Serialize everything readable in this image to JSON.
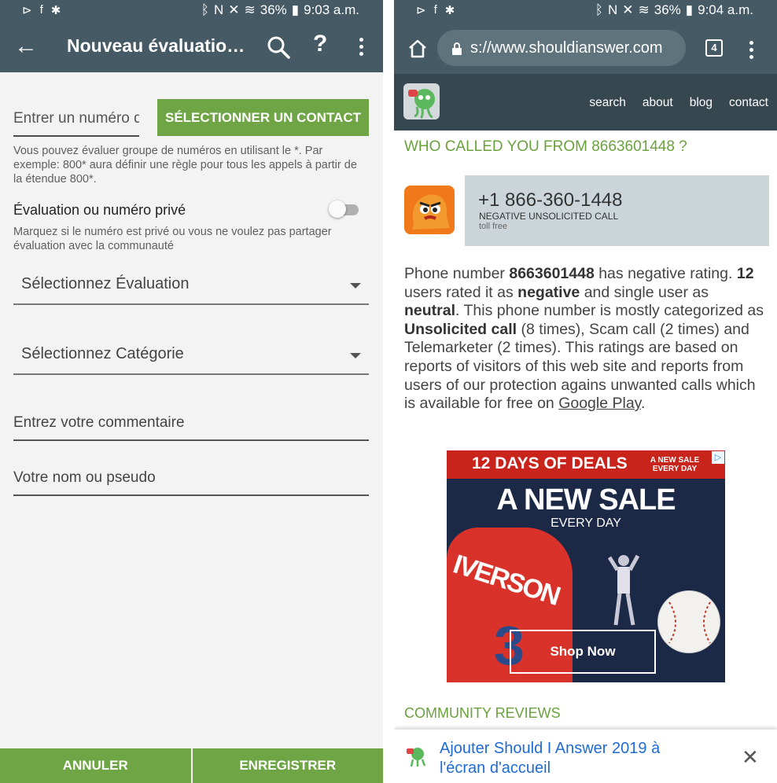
{
  "left": {
    "status": {
      "signal": "36%",
      "time": "9:03 a.m."
    },
    "appbar": {
      "title": "Nouveau évaluation…",
      "help": "?"
    },
    "number_placeholder": "Entrer un numéro de",
    "select_contact_label": "SÉLECTIONNER UN CONTACT",
    "group_hint": "Vous pouvez évaluer groupe de numéros en utilisant le *. Par exemple: 800* aura définir une règle pour tous les appels à partir de la étendue 800*.",
    "private_label": "Évaluation ou numéro privé",
    "private_hint": "Marquez si le numéro est privé ou vous ne voulez pas partager évaluation avec la communauté",
    "rating_select": "Sélectionnez Évaluation",
    "category_select": "Sélectionnez Catégorie",
    "comment_placeholder": "Entrez votre commentaire",
    "name_placeholder": "Votre nom ou pseudo",
    "cancel_label": "ANNULER",
    "save_label": "ENREGISTRER"
  },
  "right": {
    "status": {
      "signal": "36%",
      "time": "9:04 a.m."
    },
    "url": "s://www.shouldianswer.com",
    "tab_count": "4",
    "nav": [
      "search",
      "about",
      "blog",
      "contact"
    ],
    "heading": "WHO CALLED YOU FROM 8663601448 ?",
    "card": {
      "phone": "+1 866-360-1448",
      "category": "NEGATIVE UNSOLICITED CALL",
      "type": "toll free"
    },
    "paragraph": {
      "p1": "Phone number ",
      "number": "8663601448",
      "p2": " has negative rating. ",
      "count": "12",
      "p3": " users rated it as ",
      "negative": "negative",
      "p4": " and single user as ",
      "neutral": "neutral",
      "p5": ". This phone number is mostly categorized as ",
      "unsolicited": "Unsolicited call",
      "p6": " (8 times), Scam call (2 times) and Telemarketer (2 times). This ratings are based on reports of visitors of this web site and reports from users of our protection agains unwanted calls which is available for free on ",
      "link": "Google Play",
      "p7": "."
    },
    "ad": {
      "top_title": "12 DAYS OF DEALS",
      "top_small": "A NEW SALE EVERY DAY",
      "headline": "A NEW SALE",
      "subline": "EVERY DAY",
      "jersey_name": "IVERSON",
      "jersey_number": "3",
      "cta": "Shop Now"
    },
    "reviews_heading": "COMMUNITY REVIEWS",
    "a2hs_text": "Ajouter Should I Answer 2019 à l'écran d'accueil"
  }
}
